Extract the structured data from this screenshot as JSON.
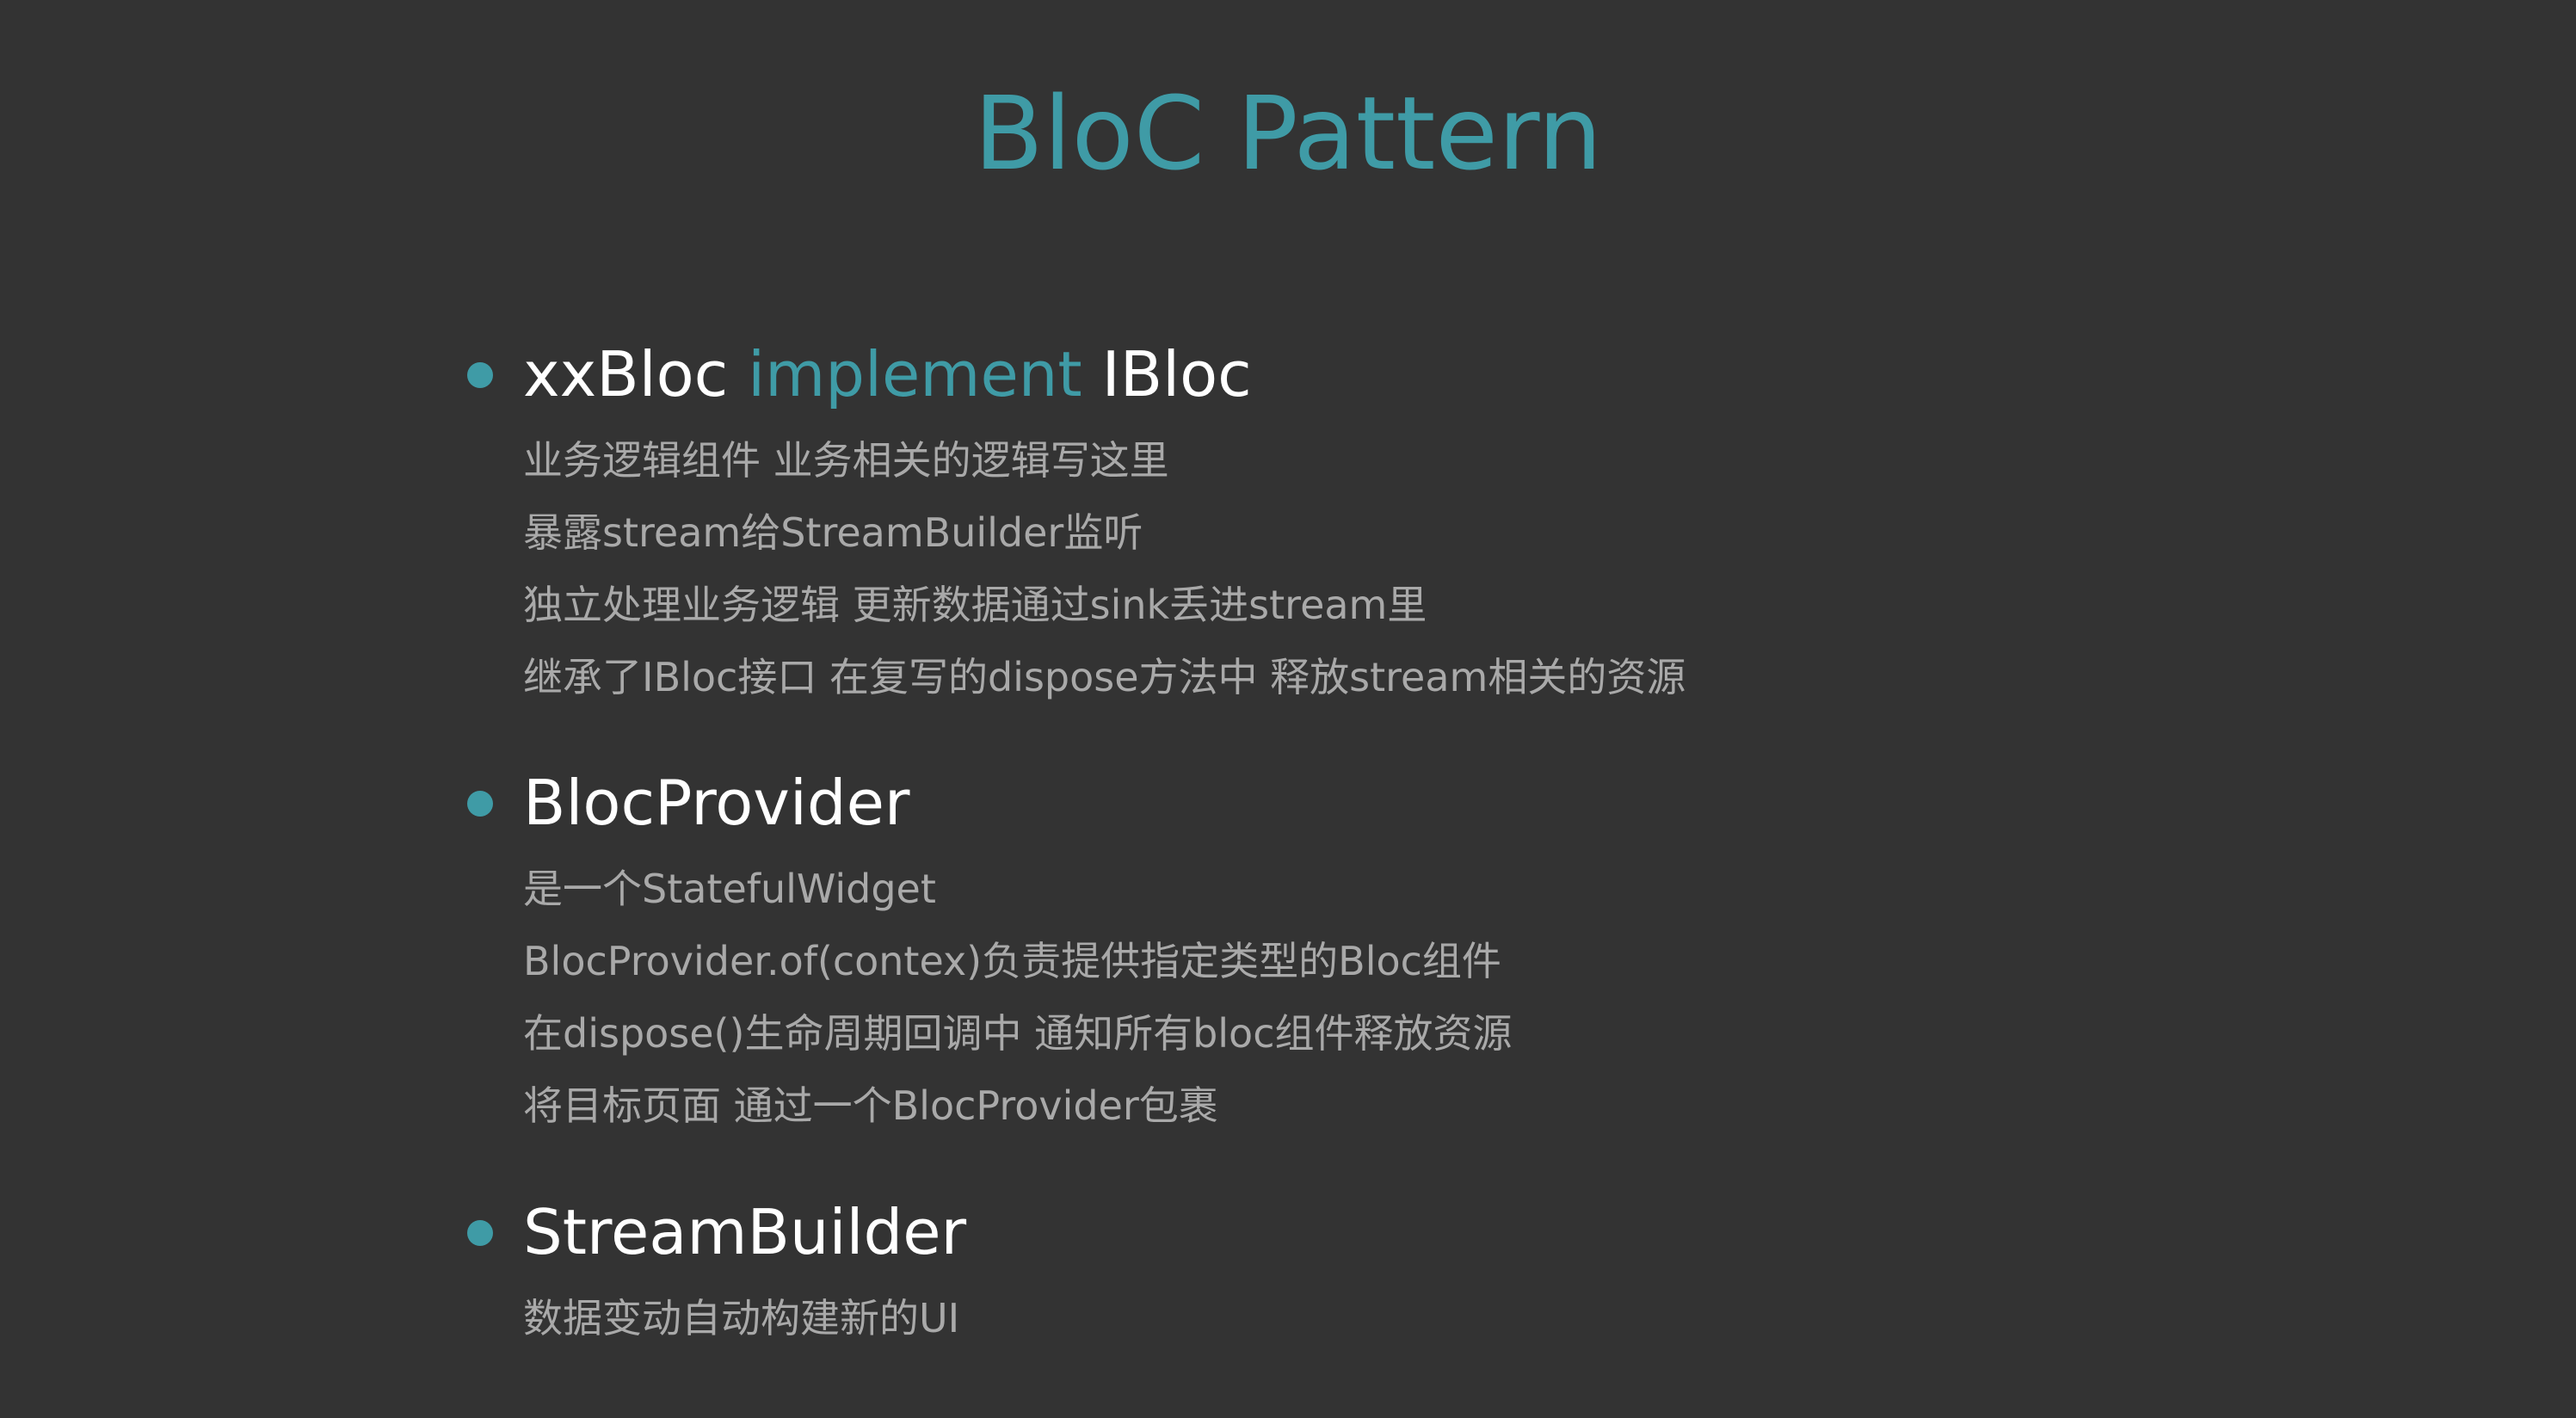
{
  "title": "BloC Pattern",
  "colors": {
    "background": "#333333",
    "accent": "#3F9BA6",
    "heading": "#FFFFFF",
    "body": "#A9A9A9"
  },
  "sections": [
    {
      "heading_parts": [
        "xxBloc",
        "implement",
        "IBloc"
      ],
      "lines": [
        "业务逻辑组件 业务相关的逻辑写这里",
        "暴露stream给StreamBuilder监听",
        "独立处理业务逻辑 更新数据通过sink丢进stream里",
        "继承了IBloc接口 在复写的dispose方法中 释放stream相关的资源"
      ]
    },
    {
      "heading": "BlocProvider",
      "lines": [
        "是一个StatefulWidget",
        "BlocProvider.of(contex)负责提供指定类型的Bloc组件",
        "在dispose()生命周期回调中 通知所有bloc组件释放资源",
        "将目标页面 通过一个BlocProvider包裹"
      ]
    },
    {
      "heading": "StreamBuilder",
      "lines": [
        "数据变动自动构建新的UI"
      ]
    }
  ]
}
